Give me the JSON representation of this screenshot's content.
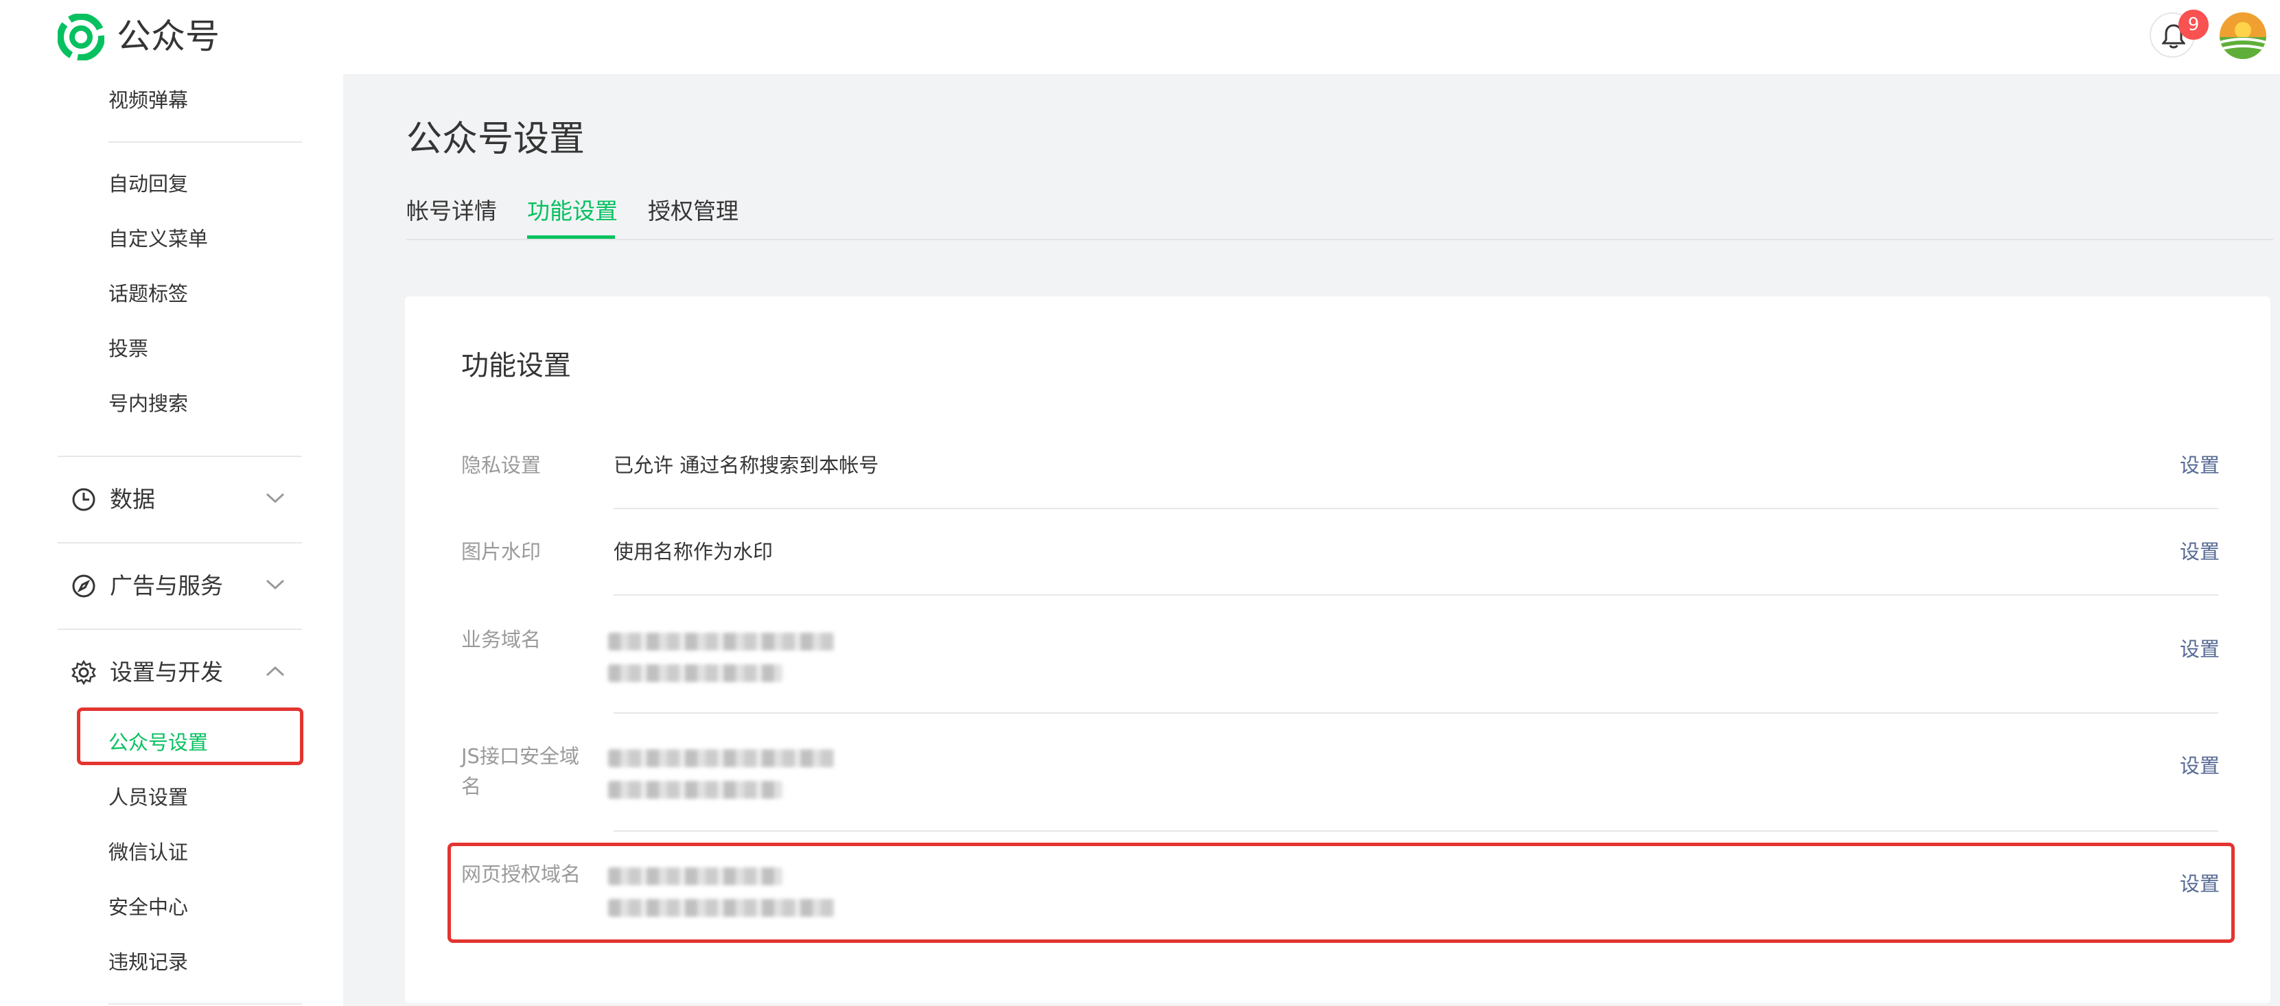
{
  "app": {
    "name": "公众号",
    "notification_count": "9",
    "colors": {
      "accent": "#07c160",
      "link": "#576b95",
      "highlight": "#e3342f",
      "badge": "#fa5151"
    }
  },
  "sidebar": {
    "items_top": [
      {
        "label": "视频弹幕"
      },
      {
        "label": "自动回复"
      },
      {
        "label": "自定义菜单"
      },
      {
        "label": "话题标签"
      },
      {
        "label": "投票"
      },
      {
        "label": "号内搜索"
      }
    ],
    "groups": [
      {
        "label": "数据",
        "icon": "clock-icon",
        "expanded": false
      },
      {
        "label": "广告与服务",
        "icon": "compass-icon",
        "expanded": false
      },
      {
        "label": "设置与开发",
        "icon": "gear-icon",
        "expanded": true
      }
    ],
    "settings_items": [
      {
        "label": "公众号设置",
        "active": true
      },
      {
        "label": "人员设置"
      },
      {
        "label": "微信认证"
      },
      {
        "label": "安全中心"
      },
      {
        "label": "违规记录"
      }
    ]
  },
  "main": {
    "title": "公众号设置",
    "tabs": [
      {
        "label": "帐号详情"
      },
      {
        "label": "功能设置",
        "active": true
      },
      {
        "label": "授权管理"
      }
    ],
    "card": {
      "title": "功能设置",
      "rows": [
        {
          "label": "隐私设置",
          "value": "已允许 通过名称搜索到本帐号",
          "action": "设置"
        },
        {
          "label": "图片水印",
          "value": "使用名称作为水印",
          "action": "设置"
        },
        {
          "label": "业务域名",
          "value": "",
          "action": "设置"
        },
        {
          "label": "JS接口安全域名",
          "value": "",
          "action": "设置"
        },
        {
          "label": "网页授权域名",
          "value": "",
          "action": "设置"
        }
      ]
    }
  }
}
